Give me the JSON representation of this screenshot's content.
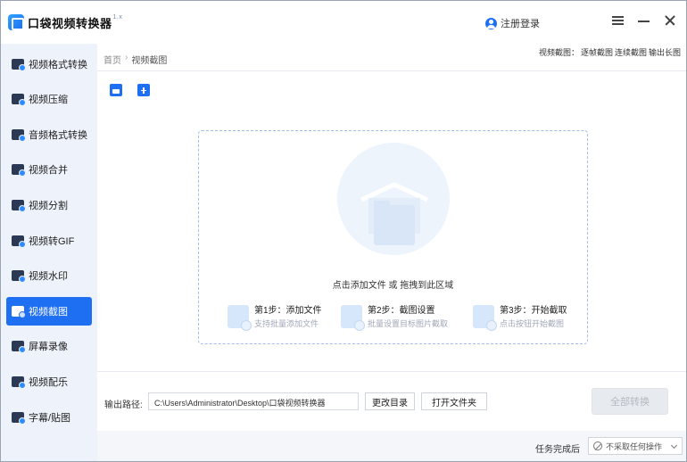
{
  "app": {
    "title": "口袋视频转换器",
    "title_tag": "1.x",
    "login_label": "注册登录"
  },
  "sidebar": {
    "items": [
      {
        "label": "视频格式转换",
        "icon": "video-convert-icon"
      },
      {
        "label": "视频压缩",
        "icon": "video-compress-icon"
      },
      {
        "label": "音频格式转换",
        "icon": "audio-convert-icon"
      },
      {
        "label": "视频合并",
        "icon": "video-merge-icon"
      },
      {
        "label": "视频分割",
        "icon": "video-split-icon"
      },
      {
        "label": "视频转GIF",
        "icon": "video-gif-icon"
      },
      {
        "label": "视频水印",
        "icon": "video-watermark-icon"
      },
      {
        "label": "视频截图",
        "icon": "video-screenshot-icon",
        "active": true
      },
      {
        "label": "屏幕录像",
        "icon": "screen-record-icon"
      },
      {
        "label": "视频配乐",
        "icon": "video-music-icon"
      },
      {
        "label": "字幕/贴图",
        "icon": "subtitle-sticker-icon"
      }
    ]
  },
  "breadcrumb": {
    "home": "首页",
    "separator": "›",
    "current": "视频截图"
  },
  "mode_links": {
    "prefix": "视频截图：",
    "frame_capture": "逐帧截图",
    "continuous_capture": "连续截图",
    "long_image": "输出长图"
  },
  "dropzone": {
    "hint": "点击添加文件 或 拖拽到此区域",
    "steps": [
      {
        "title": "第1步：添加文件",
        "desc": "支持批量添加文件"
      },
      {
        "title": "第2步：截图设置",
        "desc": "批量设置目标图片截取"
      },
      {
        "title": "第3步：开始截取",
        "desc": "点击按钮开始截图"
      }
    ]
  },
  "output": {
    "label": "输出路径:",
    "path": "C:\\Users\\Administrator\\Desktop\\口袋视频转换器",
    "change_dir": "更改目录",
    "open_folder": "打开文件夹",
    "convert_all": "全部转换"
  },
  "task_complete": {
    "label": "任务完成后",
    "selected": "不采取任何操作"
  },
  "colors": {
    "accent": "#1f6ff2",
    "sidebar_bg": "#eef3fb"
  }
}
